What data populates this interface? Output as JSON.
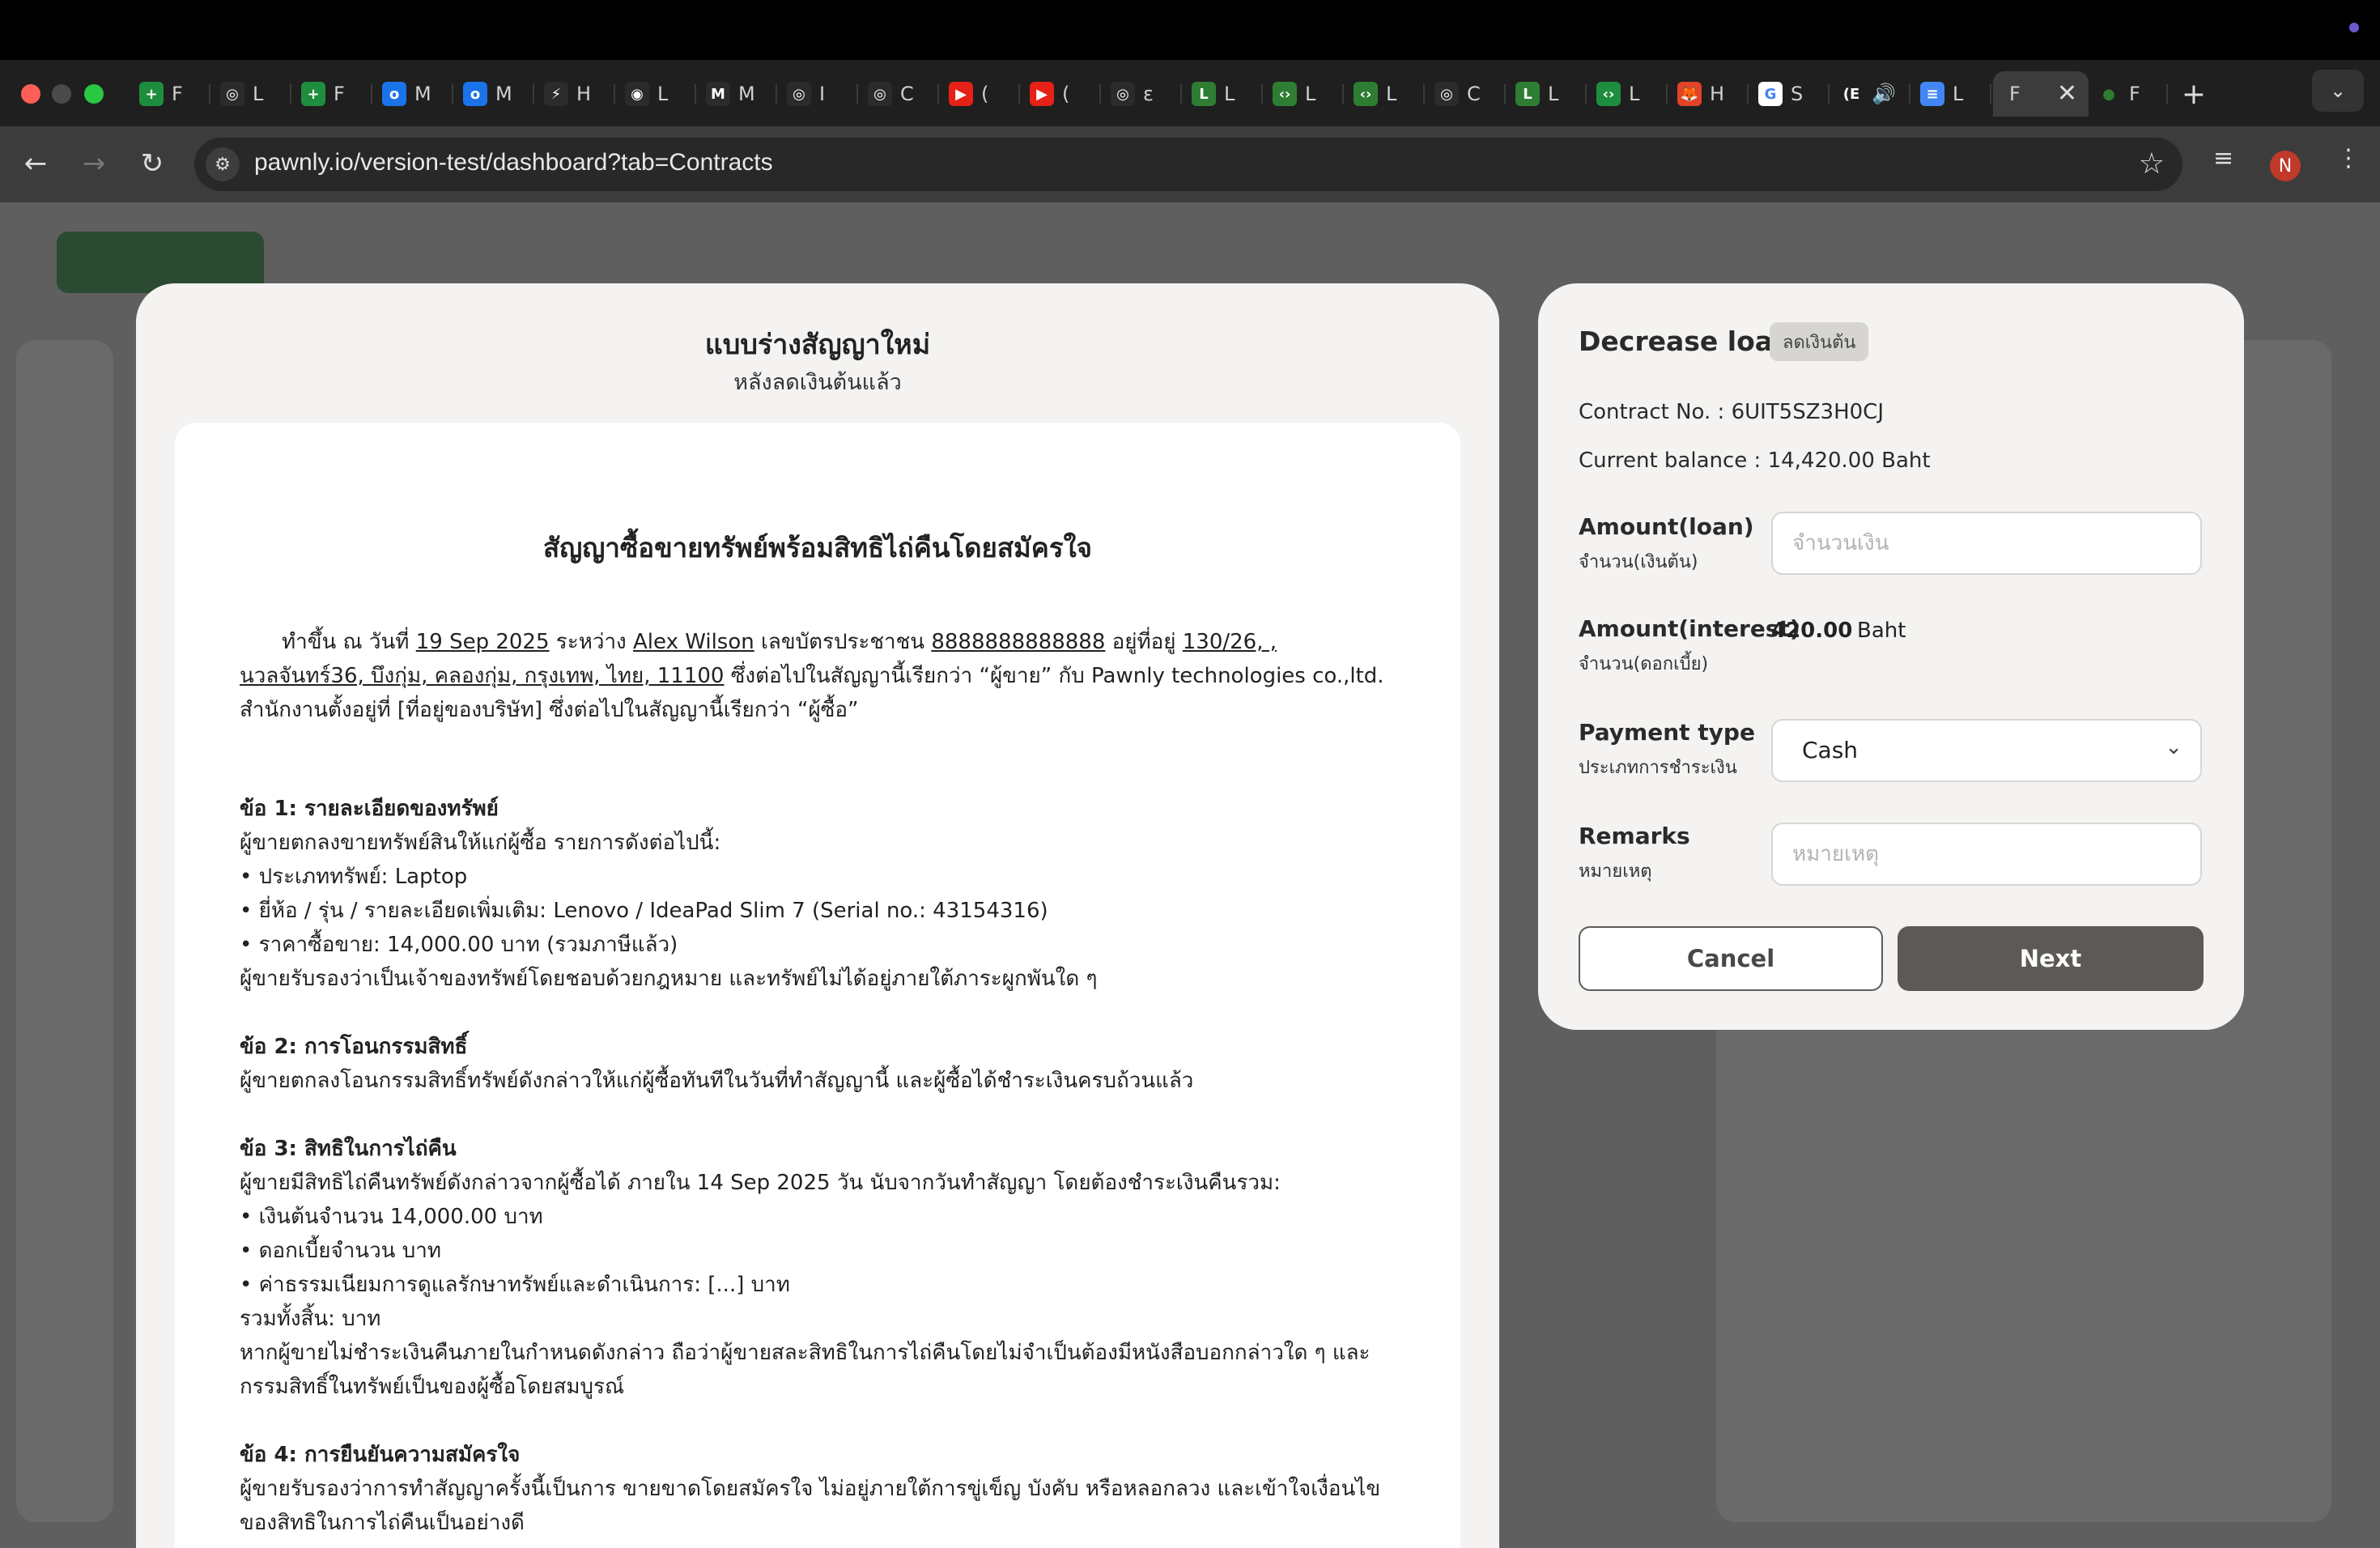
{
  "browser": {
    "url": "pawnly.io/version-test/dashboard?tab=Contracts",
    "tabs": [
      {
        "fav": "+",
        "color": "#1e8e3e",
        "title": "F"
      },
      {
        "fav": "◎",
        "color": "#2b2b2b",
        "title": "L"
      },
      {
        "fav": "+",
        "color": "#1e8e3e",
        "title": "F"
      },
      {
        "fav": "o",
        "color": "#1a73e8",
        "title": "M"
      },
      {
        "fav": "o",
        "color": "#1a73e8",
        "title": "M"
      },
      {
        "fav": "⚡",
        "color": "#2b2b2b",
        "title": "H"
      },
      {
        "fav": "◉",
        "color": "#2b2b2b",
        "title": "L"
      },
      {
        "fav": "M",
        "color": "#2b2b2b",
        "title": "M"
      },
      {
        "fav": "◎",
        "color": "#2b2b2b",
        "title": "I"
      },
      {
        "fav": "◎",
        "color": "#2b2b2b",
        "title": "C"
      },
      {
        "fav": "▶",
        "color": "#e62117",
        "title": "("
      },
      {
        "fav": "▶",
        "color": "#e62117",
        "title": "("
      },
      {
        "fav": "◎",
        "color": "#2b2b2b",
        "title": "ε"
      },
      {
        "fav": "L",
        "color": "#2e7d32",
        "title": "L"
      },
      {
        "fav": "‹›",
        "color": "#2e7d32",
        "title": "L"
      },
      {
        "fav": "‹›",
        "color": "#2e7d32",
        "title": "L"
      },
      {
        "fav": "◎",
        "color": "#2b2b2b",
        "title": "C"
      },
      {
        "fav": "L",
        "color": "#2e7d32",
        "title": "L"
      },
      {
        "fav": "‹›",
        "color": "#1e8e3e",
        "title": "L"
      },
      {
        "fav": "🦊",
        "color": "#e24329",
        "title": "H"
      },
      {
        "fav": "G",
        "color": "#ffffff",
        "title": "S"
      },
      {
        "fav": "(E",
        "color": "#1f1f1f",
        "title": "🔊"
      },
      {
        "fav": "≡",
        "color": "#4285f4",
        "title": "L"
      }
    ],
    "active_tab_title": "F",
    "last_tab": {
      "fav": "●",
      "color": "#2e7d32",
      "title": "F"
    },
    "avatar_initial": "N"
  },
  "contract_preview": {
    "title": "แบบร่างสัญญาใหม่",
    "subtitle": "หลังลดเงินต้นแล้ว",
    "doc_title": "สัญญาซื้อขายทรัพย์พร้อมสิทธิไถ่คืนโดยสมัครใจ",
    "intro": {
      "p1": "ทำขึ้น ณ วันที่ ",
      "date": "19 Sep 2025",
      "p2": " ระหว่าง ",
      "name": " Alex Wilson",
      "p3": " เลขบัตรประชาชน ",
      "id_no": "8888888888888",
      "p4": " อยู่ที่อยู่ ",
      "address": "130/26, , นวลจันทร์36, บึงกุ่ม, คลองกุ่ม, กรุงเทพ, ไทย, 11100",
      "p5": " ซึ่งต่อไปในสัญญานี้เรียกว่า “ผู้ขาย” กับ Pawnly technologies co.,ltd. สำนักงานตั้งอยู่ที่ [ที่อยู่ของบริษัท] ซึ่งต่อไปในสัญญานี้เรียกว่า “ผู้ซื้อ”"
    },
    "sec1": {
      "heading": "ข้อ 1: รายละเอียดของทรัพย์",
      "lines": [
        "ผู้ขายตกลงขายทรัพย์สินให้แก่ผู้ซื้อ รายการดังต่อไปนี้:",
        "• ประเภททรัพย์: Laptop",
        "• ยี่ห้อ / รุ่น / รายละเอียดเพิ่มเติม: Lenovo / IdeaPad Slim 7 (Serial no.: 43154316)",
        "• ราคาซื้อขาย: 14,000.00 บาท (รวมภาษีแล้ว)",
        "ผู้ขายรับรองว่าเป็นเจ้าของทรัพย์โดยชอบด้วยกฎหมาย และทรัพย์ไม่ได้อยู่ภายใต้ภาระผูกพันใด ๆ"
      ]
    },
    "sec2": {
      "heading": "ข้อ 2: การโอนกรรมสิทธิ์",
      "lines": [
        "ผู้ขายตกลงโอนกรรมสิทธิ์ทรัพย์ดังกล่าวให้แก่ผู้ซื้อทันทีในวันที่ทำสัญญานี้ และผู้ซื้อได้ชำระเงินครบถ้วนแล้ว"
      ]
    },
    "sec3": {
      "heading": "ข้อ 3: สิทธิในการไถ่คืน",
      "lines": [
        "ผู้ขายมีสิทธิไถ่คืนทรัพย์ดังกล่าวจากผู้ซื้อได้ ภายใน 14 Sep 2025 วัน นับจากวันทำสัญญา โดยต้องชำระเงินคืนรวม:",
        "• เงินต้นจำนวน 14,000.00 บาท",
        "• ดอกเบี้ยจำนวน  บาท",
        "• ค่าธรรมเนียมการดูแลรักษาทรัพย์และดำเนินการ: [...] บาท",
        "รวมทั้งสิ้น:  บาท",
        "หากผู้ขายไม่ชำระเงินคืนภายในกำหนดดังกล่าว ถือว่าผู้ขายสละสิทธิในการไถ่คืนโดยไม่จำเป็นต้องมีหนังสือบอกกล่าวใด ๆ และกรรมสิทธิ์ในทรัพย์เป็นของผู้ซื้อโดยสมบูรณ์"
      ]
    },
    "sec4": {
      "heading": "ข้อ 4: การยืนยันความสมัครใจ",
      "lines": [
        "ผู้ขายรับรองว่าการทำสัญญาครั้งนี้เป็นการ ขายขาดโดยสมัครใจ ไม่อยู่ภายใต้การขู่เข็ญ บังคับ หรือหลอกลวง และเข้าใจเงื่อนไขของสิทธิในการไถ่คืนเป็นอย่างดี"
      ]
    }
  },
  "decrease_loan": {
    "title": "Decrease loan",
    "badge": "ลดเงินต้น",
    "contract_no": "Contract No. : 6UIT5SZ3H0CJ",
    "current_balance": "Current balance : 14,420.00 Baht",
    "amount_loan": {
      "label": "Amount(loan)",
      "sub": "จำนวน(เงินต้น)",
      "placeholder": "จำนวนเงิน",
      "value": ""
    },
    "amount_interest": {
      "label": "Amount(interest)",
      "sub": "จำนวน(ดอกเบี้ย)",
      "value": "420.00",
      "unit": "Baht"
    },
    "payment_type": {
      "label": "Payment type",
      "sub": "ประเภทการชำระเงิน",
      "selected": "Cash"
    },
    "remarks": {
      "label": "Remarks",
      "sub": "หมายเหตุ",
      "placeholder": "หมายเหตุ",
      "value": ""
    },
    "cancel_label": "Cancel",
    "next_label": "Next"
  }
}
